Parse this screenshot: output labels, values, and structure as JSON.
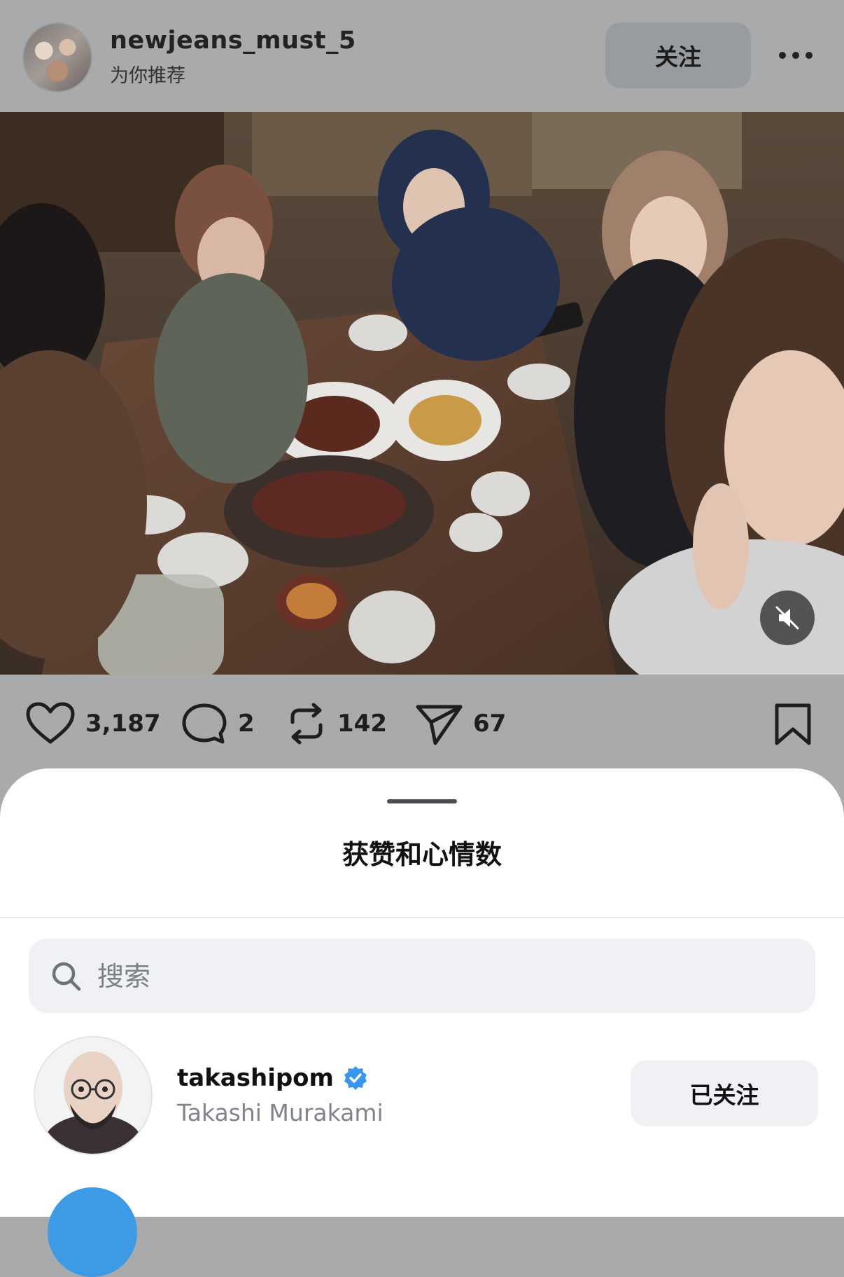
{
  "post": {
    "username": "newjeans_must_5",
    "subtitle": "为你推荐",
    "follow_label": "关注"
  },
  "actions": {
    "likes": "3,187",
    "comments": "2",
    "reposts": "142",
    "shares": "67"
  },
  "sheet": {
    "title": "获赞和心情数",
    "search_placeholder": "搜索",
    "users": [
      {
        "handle": "takashipom",
        "name": "Takashi Murakami",
        "verified": true,
        "button_label": "已关注"
      }
    ]
  },
  "colors": {
    "dim_overlay": "#a8aaab",
    "verified_blue": "#3797f0",
    "search_bg": "#eff1f4"
  }
}
